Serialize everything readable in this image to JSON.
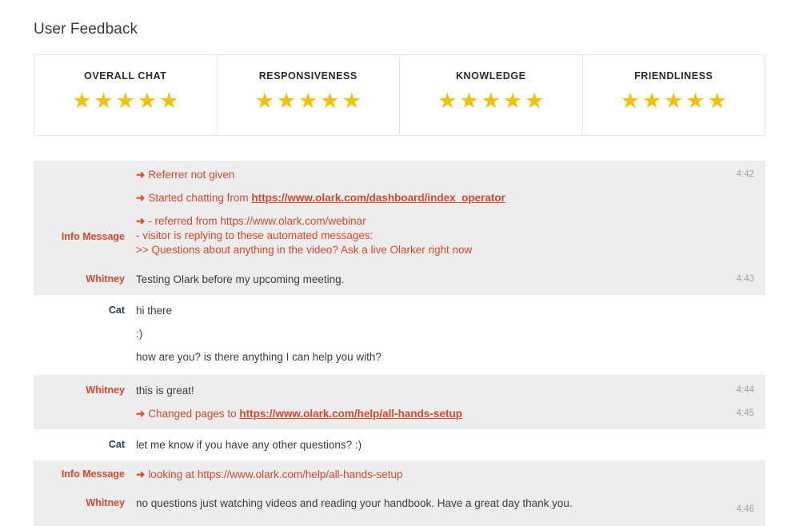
{
  "page": {
    "title": "User Feedback"
  },
  "ratings": {
    "star_color": "#f2c200",
    "star_glyph": "★",
    "cards": [
      {
        "label": "OVERALL CHAT",
        "rating": 5,
        "max": 5
      },
      {
        "label": "RESPONSIVENESS",
        "rating": 5,
        "max": 5
      },
      {
        "label": "KNOWLEDGE",
        "rating": 5,
        "max": 5
      },
      {
        "label": "FRIENDLINESS",
        "rating": 5,
        "max": 5
      }
    ]
  },
  "transcript": {
    "arrow_glyph": "➜",
    "rows": [
      {
        "speaker": "Info Message",
        "speaker_type": "info",
        "time": "4:42",
        "lines": [
          {
            "arrow": true,
            "text": "Referrer not given"
          },
          {
            "arrow": true,
            "text": "Started chatting from ",
            "link": "https://www.olark.com/dashboard/index_operator"
          },
          {
            "arrow": true,
            "text": "- referred from https://www.olark.com/webinar"
          },
          {
            "arrow": false,
            "text": "- visitor is replying to these automated messages:"
          },
          {
            "arrow": false,
            "text": ">> Questions about anything in the video? Ask a live Olarker right now"
          }
        ]
      },
      {
        "speaker": "Whitney",
        "speaker_type": "visitor",
        "time": "4:43",
        "lines": [
          {
            "arrow": false,
            "text": "Testing Olark before my upcoming meeting."
          }
        ]
      },
      {
        "speaker": "Cat",
        "speaker_type": "operator",
        "time": "",
        "lines": [
          {
            "arrow": false,
            "text": "hi there"
          },
          {
            "arrow": false,
            "text": ":)"
          },
          {
            "arrow": false,
            "text": "how are you? is there anything I can help you with?"
          }
        ]
      },
      {
        "speaker": "Whitney",
        "speaker_type": "visitor",
        "time": "4:44",
        "lines": [
          {
            "arrow": false,
            "text": "this is great!"
          }
        ]
      },
      {
        "speaker": "",
        "speaker_type": "visitor",
        "time": "4:45",
        "lines": [
          {
            "arrow": true,
            "text": "Changed pages to ",
            "link": "https://www.olark.com/help/all-hands-setup"
          }
        ]
      },
      {
        "speaker": "Cat",
        "speaker_type": "operator",
        "time": "",
        "lines": [
          {
            "arrow": false,
            "text": "let me know if you have any other questions? :)"
          }
        ]
      },
      {
        "speaker": "Info Message",
        "speaker_type": "info",
        "time": "",
        "lines": [
          {
            "arrow": true,
            "text": "looking at https://www.olark.com/help/all-hands-setup"
          }
        ]
      },
      {
        "speaker": "Whitney",
        "speaker_type": "visitor",
        "time": "4:46",
        "lines": [
          {
            "arrow": false,
            "text": "no questions just watching videos and reading your handbook. Have a great day thank you."
          }
        ]
      }
    ]
  }
}
